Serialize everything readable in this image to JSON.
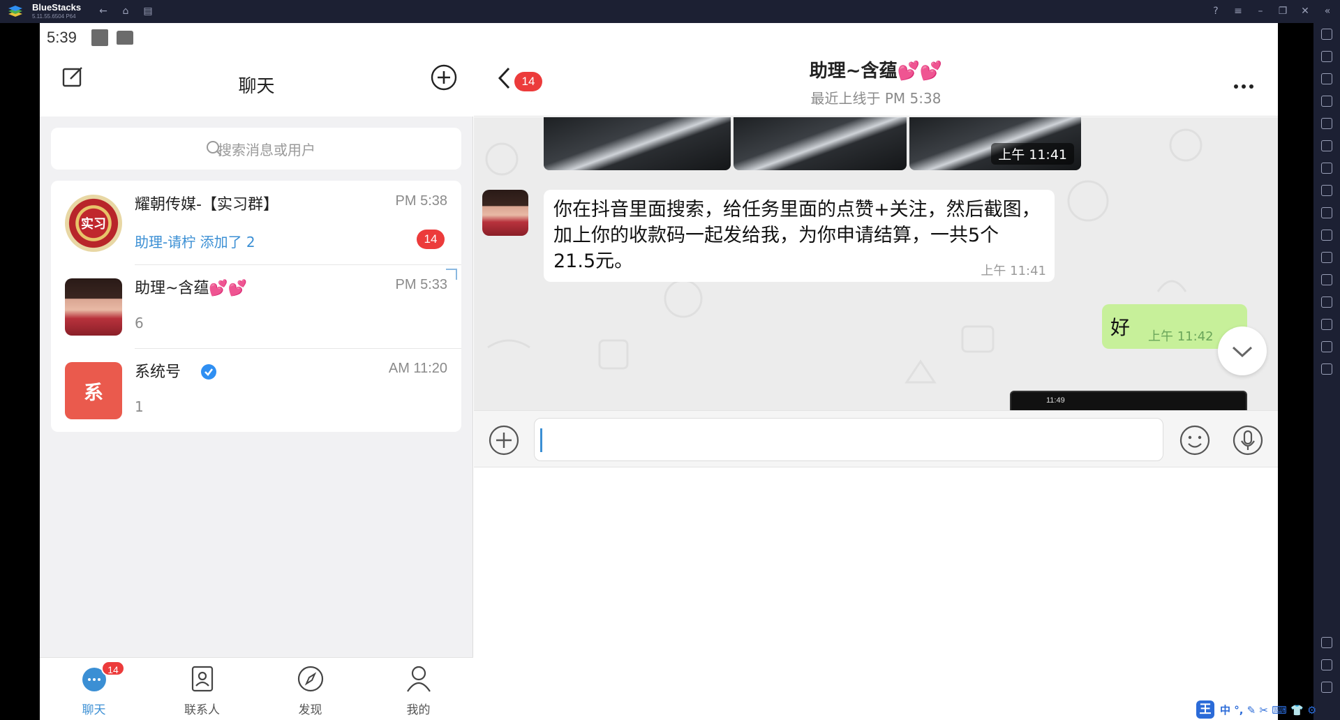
{
  "window": {
    "app_name": "BlueStacks",
    "version": "5.11.55.6504  P64"
  },
  "status_bar": {
    "time": "5:39"
  },
  "left_pane": {
    "title": "聊天",
    "search_placeholder": "搜索消息或用户",
    "chats": [
      {
        "name": "耀朝传媒-【实习群】",
        "time": "PM 5:38",
        "preview": "助理-请柠 添加了 2",
        "unread": "14",
        "avatar_text": "实习"
      },
      {
        "name": "助理~含蕴💕💕",
        "time": "PM 5:33",
        "preview": "6"
      },
      {
        "name": "系统号",
        "time": "AM 11:20",
        "preview": "1",
        "avatar_text": "系"
      }
    ],
    "tabs": [
      {
        "label": "聊天",
        "badge": "14",
        "icon": "chat-bubble-icon"
      },
      {
        "label": "联系人",
        "icon": "contacts-icon"
      },
      {
        "label": "发现",
        "icon": "compass-icon"
      },
      {
        "label": "我的",
        "icon": "person-icon"
      }
    ]
  },
  "right_pane": {
    "back_badge": "14",
    "title": "助理~含蕴💕💕",
    "subtitle": "最近上线于 PM 5:38",
    "image_message_time": "上午 11:41",
    "incoming_message": {
      "text": "你在抖音里面搜索，给任务里面的点赞+关注，然后截图，加上你的收款码一起发给我，为你申请结算，一共5个  21.5元。",
      "time": "上午 11:41"
    },
    "outgoing_message": {
      "text": "好",
      "time": "上午 11:42",
      "status": "✓✓"
    },
    "preview_status_text": "11:49",
    "input_value": ""
  },
  "ime": {
    "chip": "王",
    "text": "中 °, ✎ ✂ ⌨ 👕 ⚙"
  },
  "colors": {
    "accent_blue": "#3b8fd4",
    "badge_red": "#ec3b3b",
    "outgoing_bubble": "#c7f09a",
    "titlebar": "#1c2033"
  }
}
